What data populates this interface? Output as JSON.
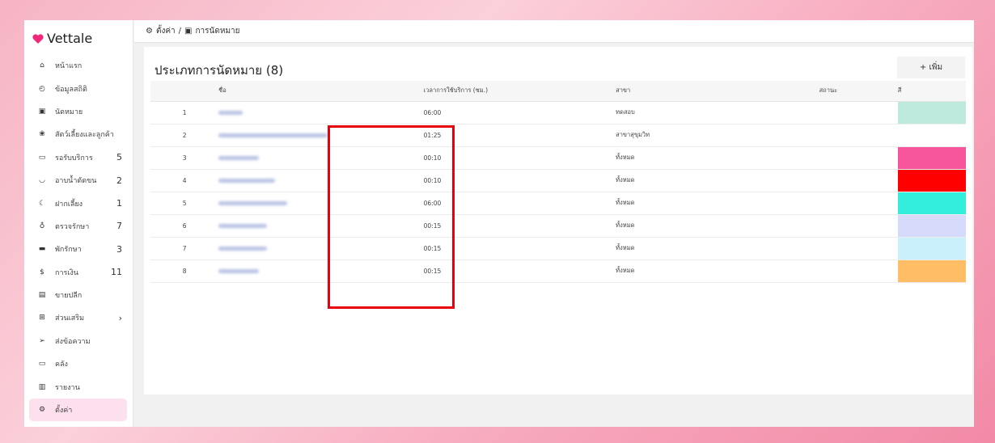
{
  "app": {
    "brand": "Vettale"
  },
  "sidebar": {
    "items": [
      {
        "label": "หน้าแรก",
        "icon": "home-icon",
        "count": ""
      },
      {
        "label": "ข้อมูลสถิติ",
        "icon": "dashboard-icon",
        "count": ""
      },
      {
        "label": "นัดหมาย",
        "icon": "calendar-icon",
        "count": ""
      },
      {
        "label": "สัตว์เลี้ยงและลูกค้า",
        "icon": "paw-icon",
        "count": ""
      },
      {
        "label": "รอรับบริการ",
        "icon": "sofa-icon",
        "count": "5"
      },
      {
        "label": "อาบน้ำตัดขน",
        "icon": "bathtub-icon",
        "count": "2"
      },
      {
        "label": "ฝากเลี้ยง",
        "icon": "moon-icon",
        "count": "1"
      },
      {
        "label": "ตรวจรักษา",
        "icon": "stethoscope-icon",
        "count": "7"
      },
      {
        "label": "พักรักษา",
        "icon": "bed-icon",
        "count": "3"
      },
      {
        "label": "การเงิน",
        "icon": "money-hand-icon",
        "count": "11"
      },
      {
        "label": "ขายปลีก",
        "icon": "cash-register-icon",
        "count": ""
      },
      {
        "label": "ส่วนเสริม",
        "icon": "plus-square-icon",
        "count": "›"
      },
      {
        "label": "ส่งข้อความ",
        "icon": "paper-plane-icon",
        "count": ""
      },
      {
        "label": "คลัง",
        "icon": "archive-icon",
        "count": ""
      },
      {
        "label": "รายงาน",
        "icon": "chart-icon",
        "count": ""
      },
      {
        "label": "ตั้งค่า",
        "icon": "gear-icon",
        "count": ""
      }
    ]
  },
  "breadcrumb": {
    "root": "ตั้งค่า",
    "sep": "/",
    "current": "การนัดหมาย"
  },
  "page": {
    "title": "ประเภทการนัดหมาย (8)",
    "add_label": "+ เพิ่ม"
  },
  "table": {
    "headers": [
      "",
      "ชื่อ",
      "เวลาการใช้บริการ (ชม.)",
      "สาขา",
      "สถานะ",
      "สี"
    ],
    "rows": [
      {
        "no": "1",
        "time": "06:00",
        "branch": "ทดสอบ",
        "status": "",
        "color": "#bdeadc"
      },
      {
        "no": "2",
        "time": "01:25",
        "branch": "สาขาสุขุมวิท",
        "status": "",
        "color": "#ffffff"
      },
      {
        "no": "3",
        "time": "00:10",
        "branch": "ทั้งหมด",
        "status": "",
        "color": "#f7559b"
      },
      {
        "no": "4",
        "time": "00:10",
        "branch": "ทั้งหมด",
        "status": "",
        "color": "#ff0000"
      },
      {
        "no": "5",
        "time": "06:00",
        "branch": "ทั้งหมด",
        "status": "",
        "color": "#33eddd"
      },
      {
        "no": "6",
        "time": "00:15",
        "branch": "ทั้งหมด",
        "status": "",
        "color": "#d6dafb"
      },
      {
        "no": "7",
        "time": "00:15",
        "branch": "ทั้งหมด",
        "status": "",
        "color": "#c9f0fb"
      },
      {
        "no": "8",
        "time": "00:15",
        "branch": "ทั้งหมด",
        "status": "",
        "color": "#ffbe66"
      }
    ]
  }
}
